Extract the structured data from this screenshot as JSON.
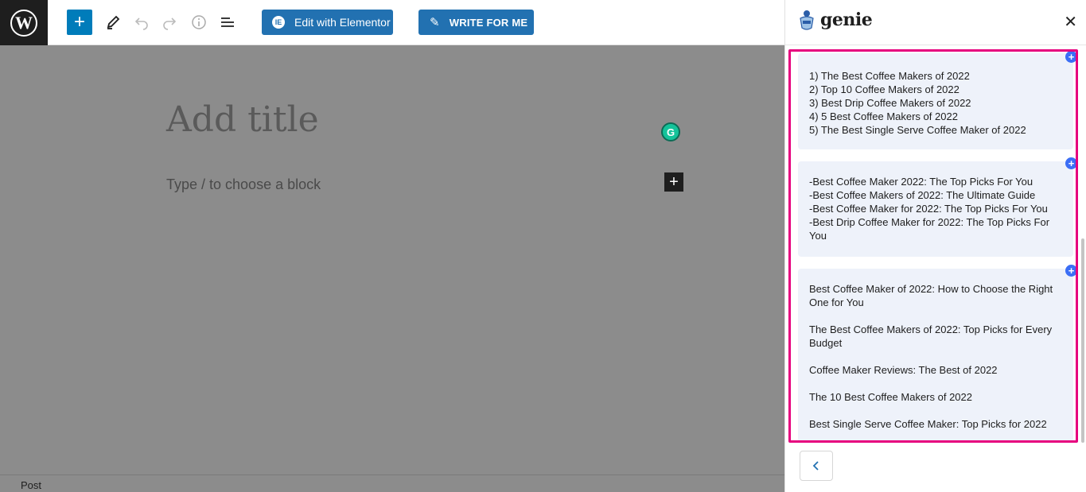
{
  "toolbar": {
    "elementor_label": "Edit with Elementor",
    "write_label": "WRITE FOR ME"
  },
  "editor": {
    "title_placeholder": "Add title",
    "block_placeholder": "Type / to choose a block"
  },
  "statusbar": {
    "label": "Post"
  },
  "panel": {
    "brand": "genie",
    "results": [
      {
        "items": [
          "1) The Best Coffee Makers of 2022",
          "2) Top 10 Coffee Makers of 2022",
          "3) Best Drip Coffee Makers of 2022",
          "4) 5 Best Coffee Makers of 2022",
          "5) The Best Single Serve Coffee Maker of 2022"
        ]
      },
      {
        "items": [
          "-Best Coffee Maker 2022: The Top Picks For You",
          "-Best Coffee Makers of 2022: The Ultimate Guide",
          "-Best Coffee Maker for 2022: The Top Picks For You",
          "-Best Drip Coffee Maker for 2022: The Top Picks For You"
        ]
      },
      {
        "items": [
          "Best Coffee Maker of 2022: How to Choose the Right One for You",
          "The Best Coffee Makers of 2022: Top Picks for Every Budget",
          "Coffee Maker Reviews: The Best of 2022",
          "The 10 Best Coffee Makers of 2022",
          "Best Single Serve Coffee Maker: Top Picks for 2022"
        ]
      }
    ]
  },
  "colors": {
    "wp_blue": "#2271b1",
    "highlight_border": "#e6007e",
    "card_bg": "#eef2fa",
    "add_badge": "#3b6ef5"
  },
  "icons": [
    "wordpress-icon",
    "plus-icon",
    "pencil-icon",
    "undo-icon",
    "redo-icon",
    "info-icon",
    "list-view-icon",
    "elementor-icon",
    "pen-icon",
    "grammarly-icon",
    "genie-logo-icon",
    "close-icon",
    "chevron-left-icon"
  ]
}
